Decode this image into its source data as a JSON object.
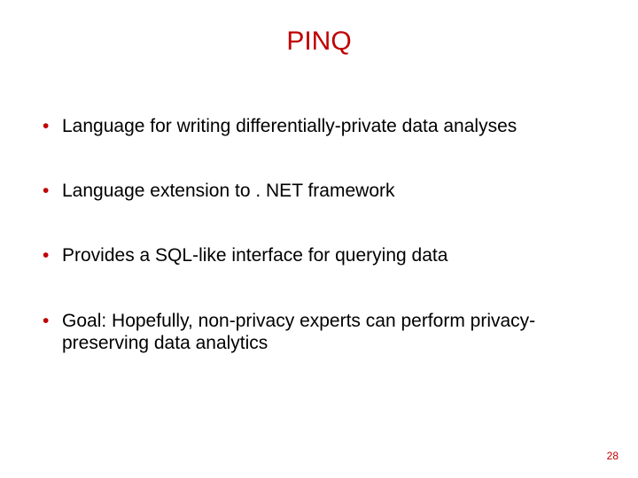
{
  "title": "PINQ",
  "bullets": [
    "Language for writing differentially-private data analyses",
    "Language extension to . NET framework",
    "Provides a SQL-like interface for querying data",
    "Goal: Hopefully, non-privacy experts can perform privacy-preserving data analytics"
  ],
  "page_number": "28"
}
